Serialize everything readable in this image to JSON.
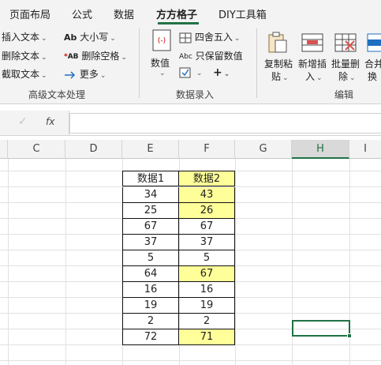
{
  "tabs": [
    "页面布局",
    "公式",
    "数据",
    "方方格子",
    "DIY工具箱"
  ],
  "active_tab": "方方格子",
  "ribbon": {
    "text_group": {
      "insert_text": "插入文本",
      "delete_text": "删除文本",
      "extract_text": "截取文本",
      "case": "大小写",
      "remove_space": "删除空格",
      "more": "更多",
      "label": "高级文本处理"
    },
    "data_group": {
      "value": "数值",
      "round": "四舍五入",
      "keep_value": "只保留数值",
      "label": "数据录入"
    },
    "edit_group": {
      "copy_paste_1": "复制粘",
      "copy_paste_2": "贴",
      "insert_new_1": "新增插",
      "insert_new_2": "入",
      "batch_delete_1": "批量删",
      "batch_delete_2": "除",
      "merge_1": "合并",
      "merge_2": "换",
      "label": "编辑"
    },
    "colors": {
      "accent": "#217346",
      "highlight": "#ffff99"
    }
  },
  "formula_bar": {
    "fx": "fx",
    "value": ""
  },
  "columns": [
    "C",
    "D",
    "E",
    "F",
    "G",
    "H",
    "I"
  ],
  "selected_column": "H",
  "table": {
    "headers": [
      "数据1",
      "数据2"
    ],
    "rows": [
      {
        "d1": "34",
        "d2": "43",
        "highlight": true
      },
      {
        "d1": "25",
        "d2": "26",
        "highlight": true
      },
      {
        "d1": "67",
        "d2": "67",
        "highlight": false
      },
      {
        "d1": "37",
        "d2": "37",
        "highlight": false
      },
      {
        "d1": "5",
        "d2": "5",
        "highlight": false
      },
      {
        "d1": "64",
        "d2": "67",
        "highlight": true
      },
      {
        "d1": "16",
        "d2": "16",
        "highlight": false
      },
      {
        "d1": "19",
        "d2": "19",
        "highlight": false
      },
      {
        "d1": "2",
        "d2": "2",
        "highlight": false
      },
      {
        "d1": "72",
        "d2": "71",
        "highlight": true
      }
    ]
  }
}
